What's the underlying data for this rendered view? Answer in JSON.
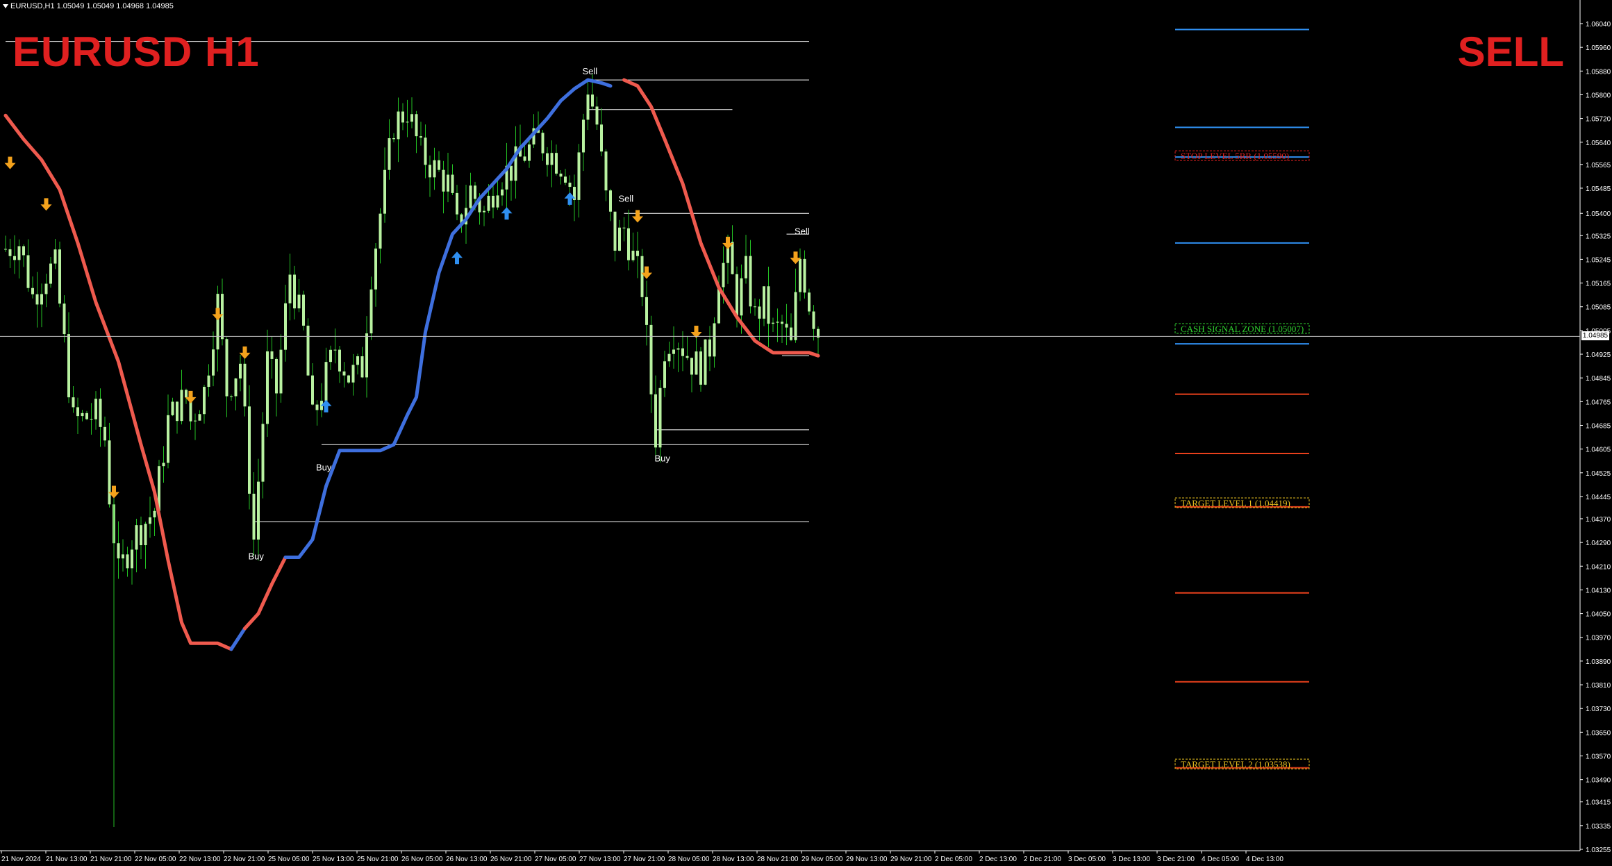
{
  "window": {
    "info_bar": "EURUSD,H1  1.05049 1.05049 1.04968 1.04985"
  },
  "overlay": {
    "symbol_timeframe": "EURUSD H1",
    "signal": "SELL"
  },
  "colors": {
    "background": "#000000",
    "candle": "#b9f2a1",
    "wick": "#23c023",
    "ma_bear": "#ef5a4e",
    "ma_bull": "#3e6fde",
    "arrow_sell": "#f4a21c",
    "arrow_buy": "#2f8ff0",
    "stop_level": "#e02020",
    "target_level": "#e8c020",
    "cash_signal": "#2fd02f",
    "line_blue": "#2f8ff0",
    "line_red": "#e8401c"
  },
  "chart_data": {
    "type": "candlestick",
    "symbol": "EURUSD",
    "timeframe": "H1",
    "current_price": "1.04985",
    "price_ticks": [
      "1.06040",
      "1.05960",
      "1.05880",
      "1.05800",
      "1.05720",
      "1.05640",
      "1.05565",
      "1.05485",
      "1.05400",
      "1.05325",
      "1.05245",
      "1.05165",
      "1.05085",
      "1.05005",
      "1.04925",
      "1.04845",
      "1.04765",
      "1.04685",
      "1.04605",
      "1.04525",
      "1.04445",
      "1.04370",
      "1.04290",
      "1.04210",
      "1.04130",
      "1.04050",
      "1.03970",
      "1.03890",
      "1.03810",
      "1.03730",
      "1.03650",
      "1.03570",
      "1.03490",
      "1.03415",
      "1.03335",
      "1.03255"
    ],
    "time_ticks": [
      "21 Nov 2024",
      "21 Nov 13:00",
      "21 Nov 21:00",
      "22 Nov 05:00",
      "22 Nov 13:00",
      "22 Nov 21:00",
      "25 Nov 05:00",
      "25 Nov 13:00",
      "25 Nov 21:00",
      "26 Nov 05:00",
      "26 Nov 13:00",
      "26 Nov 21:00",
      "27 Nov 05:00",
      "27 Nov 13:00",
      "27 Nov 21:00",
      "28 Nov 05:00",
      "28 Nov 13:00",
      "28 Nov 21:00",
      "29 Nov 05:00",
      "29 Nov 13:00",
      "29 Nov 21:00",
      "2 Dec 05:00",
      "2 Dec 13:00",
      "2 Dec 21:00",
      "3 Dec 05:00",
      "3 Dec 13:00",
      "3 Dec 21:00",
      "4 Dec 05:00",
      "4 Dec 13:00"
    ],
    "signal_labels": [
      {
        "text": "Sell",
        "bar": 129,
        "price": 1.0585
      },
      {
        "text": "Sell",
        "bar": 137,
        "price": 1.0542
      },
      {
        "text": "Sell",
        "bar": 176,
        "price": 1.0531
      },
      {
        "text": "Buy",
        "bar": 70,
        "price": 1.0458
      },
      {
        "text": "Buy",
        "bar": 55,
        "price": 1.0428
      },
      {
        "text": "Buy",
        "bar": 145,
        "price": 1.0461
      }
    ],
    "levels": [
      {
        "label": "STOP LEVEL 5RR (1.05590)",
        "price": 1.0559,
        "type": "stop"
      },
      {
        "label": "CASH SIGNAL ZONE (1.05007)",
        "price": 1.05007,
        "type": "cash"
      },
      {
        "label": "TARGET LEVEL 1 (1.04419)",
        "price": 1.04419,
        "type": "target"
      },
      {
        "label": "TARGET LEVEL 2 (1.03538)",
        "price": 1.03538,
        "type": "target"
      }
    ],
    "anchors": [
      [
        0,
        1.0528
      ],
      [
        3,
        1.053
      ],
      [
        6,
        1.0512
      ],
      [
        9,
        1.052
      ],
      [
        11,
        1.0522
      ],
      [
        15,
        1.047
      ],
      [
        20,
        1.0472
      ],
      [
        22,
        1.0464
      ],
      [
        23,
        1.0445
      ],
      [
        25,
        1.0418
      ],
      [
        28,
        1.043
      ],
      [
        33,
        1.044
      ],
      [
        36,
        1.047
      ],
      [
        38,
        1.0475
      ],
      [
        40,
        1.0478
      ],
      [
        41,
        1.047
      ],
      [
        44,
        1.048
      ],
      [
        47,
        1.051
      ],
      [
        49,
        1.048
      ],
      [
        52,
        1.049
      ],
      [
        55,
        1.043
      ],
      [
        58,
        1.049
      ],
      [
        60,
        1.048
      ],
      [
        63,
        1.052
      ],
      [
        66,
        1.05
      ],
      [
        68,
        1.047
      ],
      [
        70,
        1.048
      ],
      [
        73,
        1.0495
      ],
      [
        76,
        1.0485
      ],
      [
        79,
        1.0488
      ],
      [
        81,
        1.052
      ],
      [
        84,
        1.055
      ],
      [
        86,
        1.057
      ],
      [
        89,
        1.0575
      ],
      [
        92,
        1.056
      ],
      [
        95,
        1.0555
      ],
      [
        98,
        1.055
      ],
      [
        100,
        1.0535
      ],
      [
        103,
        1.0548
      ],
      [
        106,
        1.054
      ],
      [
        109,
        1.0552
      ],
      [
        112,
        1.0555
      ],
      [
        115,
        1.056
      ],
      [
        118,
        1.0565
      ],
      [
        121,
        1.056
      ],
      [
        124,
        1.0555
      ],
      [
        126,
        1.0545
      ],
      [
        128,
        1.0572
      ],
      [
        129,
        1.0583
      ],
      [
        131,
        1.057
      ],
      [
        133,
        1.0545
      ],
      [
        135,
        1.053
      ],
      [
        137,
        1.0535
      ],
      [
        139,
        1.0525
      ],
      [
        141,
        1.0515
      ],
      [
        143,
        1.048
      ],
      [
        144,
        1.0465
      ],
      [
        146,
        1.0495
      ],
      [
        148,
        1.05
      ],
      [
        150,
        1.0495
      ],
      [
        152,
        1.049
      ],
      [
        154,
        1.0488
      ],
      [
        156,
        1.0495
      ],
      [
        158,
        1.052
      ],
      [
        160,
        1.0525
      ],
      [
        162,
        1.051
      ],
      [
        164,
        1.052
      ],
      [
        166,
        1.0505
      ],
      [
        168,
        1.051
      ],
      [
        170,
        1.05
      ],
      [
        172,
        1.0502
      ],
      [
        174,
        1.0495
      ],
      [
        176,
        1.0525
      ],
      [
        178,
        1.051
      ],
      [
        180,
        1.05
      ]
    ],
    "moving_average": [
      [
        0,
        1.0573
      ],
      [
        4,
        1.0565
      ],
      [
        8,
        1.0558
      ],
      [
        12,
        1.0548
      ],
      [
        16,
        1.053
      ],
      [
        20,
        1.051
      ],
      [
        25,
        1.049
      ],
      [
        30,
        1.0462
      ],
      [
        33,
        1.0446
      ],
      [
        36,
        1.0423
      ],
      [
        39,
        1.0402
      ],
      [
        41,
        1.0395
      ],
      [
        44,
        1.0395
      ],
      [
        47,
        1.0395
      ],
      [
        50,
        1.0393
      ],
      [
        53,
        1.04
      ],
      [
        56,
        1.0405
      ],
      [
        59,
        1.0415
      ],
      [
        62,
        1.0424
      ],
      [
        65,
        1.0424
      ],
      [
        68,
        1.043
      ],
      [
        71,
        1.0448
      ],
      [
        74,
        1.046
      ],
      [
        77,
        1.046
      ],
      [
        80,
        1.046
      ],
      [
        83,
        1.046
      ],
      [
        86,
        1.0462
      ],
      [
        89,
        1.0472
      ],
      [
        91,
        1.0478
      ],
      [
        93,
        1.05
      ],
      [
        96,
        1.052
      ],
      [
        99,
        1.0533
      ],
      [
        102,
        1.0538
      ],
      [
        105,
        1.0545
      ],
      [
        108,
        1.055
      ],
      [
        111,
        1.0555
      ],
      [
        114,
        1.0562
      ],
      [
        117,
        1.0567
      ],
      [
        120,
        1.0572
      ],
      [
        123,
        1.0578
      ],
      [
        126,
        1.0582
      ],
      [
        129,
        1.0585
      ],
      [
        132,
        1.0584
      ],
      [
        134,
        1.0583
      ],
      [
        137,
        1.0585
      ],
      [
        140,
        1.0583
      ],
      [
        143,
        1.0576
      ],
      [
        146,
        1.0565
      ],
      [
        150,
        1.055
      ],
      [
        154,
        1.053
      ],
      [
        158,
        1.0515
      ],
      [
        162,
        1.0505
      ],
      [
        166,
        1.0497
      ],
      [
        170,
        1.0493
      ],
      [
        174,
        1.0493
      ],
      [
        178,
        1.0493
      ],
      [
        180,
        1.0492
      ]
    ],
    "ma_segments": [
      {
        "from": 0,
        "to": 50,
        "trend": "down"
      },
      {
        "from": 50,
        "to": 53,
        "trend": "up"
      },
      {
        "from": 53,
        "to": 62,
        "trend": "down"
      },
      {
        "from": 62,
        "to": 135,
        "trend": "up"
      },
      {
        "from": 135,
        "to": 180,
        "trend": "down"
      }
    ],
    "sell_arrows": [
      [
        1,
        1.0557
      ],
      [
        9,
        1.0543
      ],
      [
        24,
        1.0446
      ],
      [
        41,
        1.0478
      ],
      [
        47,
        1.0506
      ],
      [
        53,
        1.0493
      ],
      [
        140,
        1.0539
      ],
      [
        142,
        1.052
      ],
      [
        153,
        1.05
      ],
      [
        160,
        1.053
      ],
      [
        175,
        1.0525
      ]
    ],
    "buy_arrows": [
      [
        71,
        1.0475
      ],
      [
        100,
        1.0525
      ],
      [
        111,
        1.054
      ],
      [
        125,
        1.0545
      ]
    ],
    "hlines": [
      {
        "bar_from": 0,
        "bar_to": 178,
        "price": 1.0598,
        "color": "#ffffff"
      },
      {
        "bar_from": 130,
        "bar_to": 178,
        "price": 1.0585,
        "color": "#ffffff"
      },
      {
        "bar_from": 129,
        "bar_to": 161,
        "price": 1.0575,
        "color": "#ffffff"
      },
      {
        "bar_from": 137,
        "bar_to": 178,
        "price": 1.054,
        "color": "#ffffff"
      },
      {
        "bar_from": 173,
        "bar_to": 178,
        "price": 1.0533,
        "color": "#ffffff"
      },
      {
        "bar_from": 144,
        "bar_to": 178,
        "price": 1.0467,
        "color": "#ffffff"
      },
      {
        "bar_from": 70,
        "bar_to": 178,
        "price": 1.0462,
        "color": "#ffffff"
      },
      {
        "bar_from": 55,
        "bar_to": 178,
        "price": 1.0436,
        "color": "#ffffff"
      },
      {
        "bar_from": 172,
        "bar_to": 178,
        "price": 1.0492,
        "color": "#ffffff"
      }
    ],
    "right_levels": [
      {
        "price": 1.0602,
        "color": "#2f8ff0"
      },
      {
        "price": 1.0569,
        "color": "#2f8ff0"
      },
      {
        "price": 1.0559,
        "color": "#2f8ff0"
      },
      {
        "price": 1.053,
        "color": "#2f8ff0"
      },
      {
        "price": 1.0496,
        "color": "#2f8ff0"
      },
      {
        "price": 1.0479,
        "color": "#e8401c"
      },
      {
        "price": 1.0459,
        "color": "#e8401c"
      },
      {
        "price": 1.0441,
        "color": "#e8401c"
      },
      {
        "price": 1.0412,
        "color": "#e8401c"
      },
      {
        "price": 1.0382,
        "color": "#e8401c"
      },
      {
        "price": 1.0353,
        "color": "#e8401c"
      }
    ]
  }
}
